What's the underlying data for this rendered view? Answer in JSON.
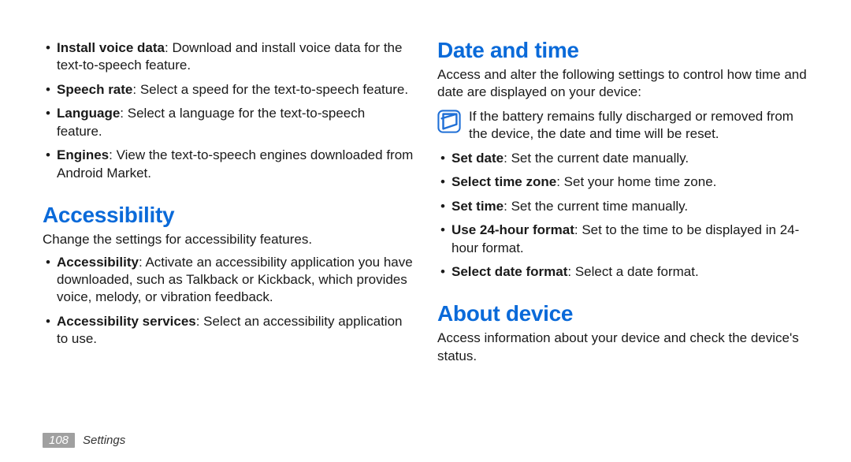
{
  "left": {
    "bullets1": [
      {
        "term": "Install voice data",
        "desc": ": Download and install voice data for the text-to-speech feature."
      },
      {
        "term": "Speech rate",
        "desc": ": Select a speed for the text-to-speech feature."
      },
      {
        "term": "Language",
        "desc": ": Select a language for the text-to-speech feature."
      },
      {
        "term": "Engines",
        "desc": ": View the text-to-speech engines downloaded from Android Market."
      }
    ],
    "heading1": "Accessibility",
    "para1": "Change the settings for accessibility features.",
    "bullets2": [
      {
        "term": "Accessibility",
        "desc": ": Activate an accessibility application you have downloaded, such as Talkback or Kickback, which provides voice, melody, or vibration feedback."
      },
      {
        "term": "Accessibility services",
        "desc": ": Select an accessibility application to use."
      }
    ]
  },
  "right": {
    "heading1": "Date and time",
    "para1": "Access and alter the following settings to control how time and date are displayed on your device:",
    "note": "If the battery remains fully discharged or removed from the device, the date and time will be reset.",
    "bullets1": [
      {
        "term": "Set date",
        "desc": ": Set the current date manually."
      },
      {
        "term": "Select time zone",
        "desc": ": Set your home time zone."
      },
      {
        "term": "Set time",
        "desc": ": Set the current time manually."
      },
      {
        "term": "Use 24-hour format",
        "desc": ": Set to the time to be displayed in 24-hour format."
      },
      {
        "term": "Select date format",
        "desc": ": Select a date format."
      }
    ],
    "heading2": "About device",
    "para2": "Access information about your device and check the device's status."
  },
  "footer": {
    "page": "108",
    "section": "Settings"
  }
}
